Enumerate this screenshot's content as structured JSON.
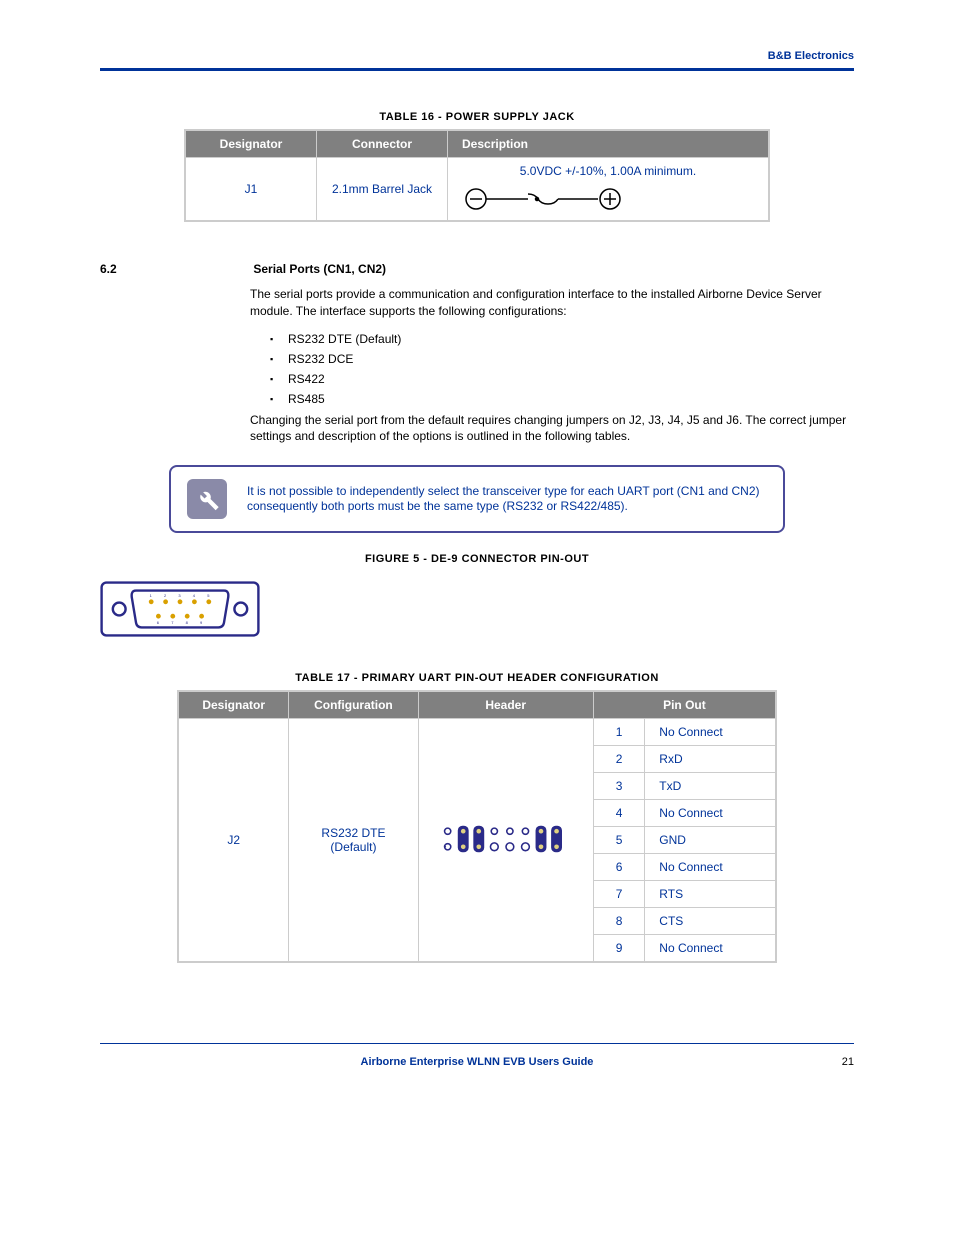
{
  "header": {
    "company": "B&B Electronics"
  },
  "table16": {
    "caption": "TABLE 16 - POWER SUPPLY JACK",
    "cols": {
      "c1": "Designator",
      "c2": "Connector",
      "c3": "Description"
    },
    "row": {
      "designator": "J1",
      "connector": "2.1mm Barrel Jack",
      "description": "5.0VDC +/-10%, 1.00A minimum."
    }
  },
  "section": {
    "num": "6.2",
    "title": "Serial Ports (CN1, CN2)",
    "para1": "The serial ports provide a communication and configuration interface to the installed Airborne Device Server module. The interface supports the following configurations:",
    "features": [
      "RS232 DTE (Default)",
      "RS232 DCE",
      "RS422",
      "RS485"
    ],
    "para2": "Changing the serial port from the default requires changing jumpers on J2, J3, J4, J5 and J6. The correct jumper settings and description of the options is outlined in the following tables."
  },
  "note": {
    "text": "It is not possible to independently select the transceiver type for each UART port (CN1 and CN2) consequently both ports must be the same type (RS232 or RS422/485)."
  },
  "figure5": {
    "caption": "FIGURE 5 - DE-9 CONNECTOR PIN-OUT"
  },
  "table17": {
    "caption": "TABLE 17 - PRIMARY UART PIN-OUT HEADER CONFIGURATION",
    "cols": {
      "c1": "Designator",
      "c2": "Configuration",
      "c3": "Header",
      "c4": "Pin Out"
    },
    "designator": "J2",
    "config": "RS232 DTE (Default)",
    "pins": [
      {
        "num": "1",
        "name": "No Connect"
      },
      {
        "num": "2",
        "name": "RxD"
      },
      {
        "num": "3",
        "name": "TxD"
      },
      {
        "num": "4",
        "name": "No Connect"
      },
      {
        "num": "5",
        "name": "GND"
      },
      {
        "num": "6",
        "name": "No Connect"
      },
      {
        "num": "7",
        "name": "RTS"
      },
      {
        "num": "8",
        "name": "CTS"
      },
      {
        "num": "9",
        "name": "No Connect"
      }
    ]
  },
  "footer": {
    "title": "Airborne Enterprise WLNN EVB Users Guide",
    "page": "21"
  }
}
